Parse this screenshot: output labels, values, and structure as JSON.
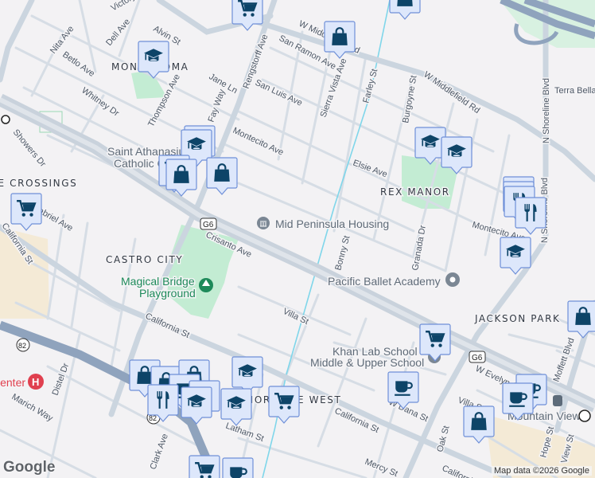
{
  "neighborhoods": [
    "MONTA LOMA",
    "THE CROSSINGS",
    "CASTRO CITY",
    "REX MANOR",
    "JACKSON PARK",
    "SHORELINE WEST"
  ],
  "streets": {
    "victory": "Victory",
    "dell": "Dell Ave",
    "alvin": "Alvin St",
    "nita": "Nita Ave",
    "betlo": "Betlo Ave",
    "whitney": "Whitney Dr",
    "thompson": "Thompson Ave",
    "jane": "Jane Ln",
    "fay": "Fay Way",
    "rengstorff": "Rengstorff Ave",
    "san_ramon": "San Ramon Ave",
    "san_luis": "San Luis Ave",
    "montecito": "Montecito Ave",
    "showers": "Showers Dr",
    "gabriel": "Gabriel Ave",
    "california": "California St",
    "middlefield": "W Middlefield Rd",
    "sierra_vista": "Sierra Vista Ave",
    "farley": "Farley St",
    "burgoyne": "Burgoyne St",
    "elsie": "Elsie Ave",
    "terra_bella": "Terra Bella",
    "shoreline": "N Shoreline Blvd",
    "crisanto": "Crisanto Ave",
    "villa": "Villa St",
    "bonny": "Bonny St",
    "granada": "Granada Dr",
    "evelyn": "W Evelyn Ave",
    "dana": "W Dana St",
    "oak": "Oak St",
    "mercy": "Mercy St",
    "hope": "Hope St",
    "view": "View St",
    "moffett": "Moffett Blvd",
    "latham": "Latham St",
    "clark": "Clark Ave",
    "distel": "Distel Dr",
    "marich": "Marich Way"
  },
  "pois": {
    "church_line1": "Saint Athanasius",
    "church_line2": "Catholic Church",
    "housing": "Mid Peninsula Housing",
    "park_line1": "Magical Bridge",
    "park_line2": "Playground",
    "ballet": "Pacific Ballet Academy",
    "khan_line1": "Khan Lab School -",
    "khan_line2": "Middle & Upper School",
    "station": "Mountain View",
    "hospital": "Center"
  },
  "shields": {
    "g6": "G6",
    "r82": "82"
  },
  "markers": [
    "cart",
    "bag",
    "school",
    "bag",
    "school",
    "school",
    "cart",
    "bag",
    "bag",
    "cart",
    "school",
    "school",
    "restaurant",
    "restaurant",
    "restaurant",
    "restaurant",
    "school",
    "cart",
    "bag",
    "coffee",
    "coffee",
    "coffee",
    "bag",
    "bag",
    "bag",
    "bag",
    "coffee",
    "restaurant",
    "restaurant",
    "school",
    "school",
    "school",
    "cart",
    "cart",
    "coffee"
  ],
  "colors": {
    "marker_fill": "#dde7fb",
    "marker_border": "#6f90d8",
    "icon": "#0d4468",
    "park": "#c3ecd3",
    "water": "#7fd6ea"
  },
  "attribution": "Map data ©2026 Google",
  "logo": "Google"
}
